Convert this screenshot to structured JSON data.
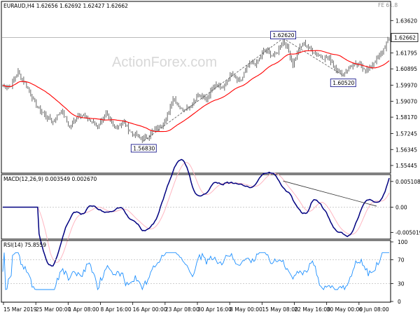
{
  "chart_data": [
    {
      "type": "line",
      "title": "EURAUD,H4  1.62656 1.62692 1.62427 1.62662",
      "corner_label": "FE 61.8",
      "watermark": "ActionForex.com",
      "ylim": [
        1.5505,
        1.6462
      ],
      "y_ticks": [
        {
          "value": 1.6362,
          "label": "1.63620"
        },
        {
          "value": 1.61795,
          "label": "1.61795"
        },
        {
          "value": 1.60895,
          "label": "1.60895"
        },
        {
          "value": 1.5997,
          "label": "1.59970"
        },
        {
          "value": 1.5907,
          "label": "1.59070"
        },
        {
          "value": 1.5817,
          "label": "1.58170"
        },
        {
          "value": 1.57245,
          "label": "1.57245"
        },
        {
          "value": 1.56345,
          "label": "1.56345"
        },
        {
          "value": 1.55445,
          "label": "1.55445"
        }
      ],
      "last_price": {
        "value": 1.62662,
        "label": "1.62662"
      },
      "fib_line": {
        "value": 1.6266
      },
      "annotations": [
        {
          "label": "1.56830",
          "value": 1.5683,
          "bar": 101
        },
        {
          "label": "1.62620",
          "value": 1.6262,
          "bar": 201
        },
        {
          "label": "1.60520",
          "value": 1.6052,
          "bar": 244
        }
      ],
      "grid": false,
      "colors": {
        "candles": "#404040",
        "ma": "#ff0000",
        "trendline": "#555555",
        "fib": "#b0b0b0"
      },
      "bar_count": 278
    },
    {
      "type": "line",
      "title": "MACD(12,26,9) 0.003549 0.002670",
      "ylim": [
        -0.0062,
        0.0062
      ],
      "y_ticks": [
        {
          "value": 0.005108,
          "label": "0.005108"
        },
        {
          "value": 0.0,
          "label": "0.00"
        },
        {
          "value": -0.005019,
          "label": "-0.005019"
        }
      ],
      "series": [
        {
          "name": "MACD",
          "color": "#000080"
        },
        {
          "name": "Signal",
          "color": "#ffb6c1"
        }
      ],
      "divergence_line": {
        "from": 0.0052,
        "to": 0.0002
      }
    },
    {
      "type": "line",
      "title": "RSI(14) 75.8559",
      "ylim": [
        0,
        100
      ],
      "y_ticks": [
        {
          "value": 100,
          "label": "100"
        },
        {
          "value": 70,
          "label": "70"
        },
        {
          "value": 30,
          "label": "30"
        },
        {
          "value": 0,
          "label": "0"
        }
      ],
      "series": [
        {
          "name": "RSI",
          "color": "#1e90ff"
        }
      ],
      "x_ticks": [
        "15 Mar 2019",
        "25 Mar 00:00",
        "1 Apr 08:00",
        "8 Apr 16:00",
        "16 Apr 00:00",
        "23 Apr 08:00",
        "30 Apr 16:00",
        "8 May 00:00",
        "15 May 08:00",
        "22 May 16:00",
        "30 May 00:00",
        "6 Jun 08:00"
      ]
    }
  ]
}
